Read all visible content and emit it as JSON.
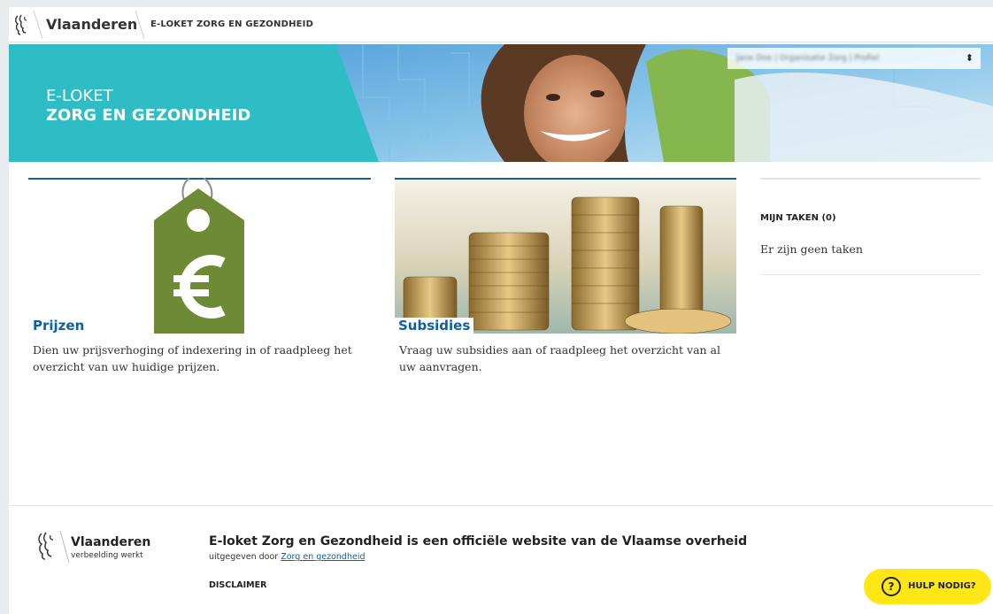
{
  "header": {
    "brand": "Vlaanderen",
    "site_name": "E-LOKET ZORG EN GEZONDHEID"
  },
  "banner": {
    "title_line1": "E-LOKET",
    "title_line2": "ZORG EN GEZONDHEID",
    "profile_selector_text": "Jane Doe | Organisatie Zorg | Profiel",
    "colors": {
      "teal": "#2ebdc4"
    }
  },
  "cards": [
    {
      "title": "Prijzen",
      "description": "Dien uw prijsverhoging of indexering in of raadpleeg het overzicht van uw huidige prijzen.",
      "image_icon": "price-tag-euro-icon"
    },
    {
      "title": "Subsidies",
      "description": "Vraag uw subsidies aan of raadpleeg het overzicht van al uw aanvragen.",
      "image_icon": "coin-stacks-image"
    }
  ],
  "tasks": {
    "heading": "MIJN TAKEN (0)",
    "empty_text": "Er zijn geen taken"
  },
  "footer": {
    "brand": "Vlaanderen",
    "tagline": "verbeelding werkt",
    "statement": "E-loket Zorg en Gezondheid is een officiële website van de Vlaamse overheid",
    "published_by_prefix": "uitgegeven door ",
    "published_by_link": "Zorg en gezondheid",
    "disclaimer": "DISCLAIMER"
  },
  "help_button": {
    "label": "HULP NODIG?",
    "icon_text": "?",
    "color": "#ffe615"
  }
}
